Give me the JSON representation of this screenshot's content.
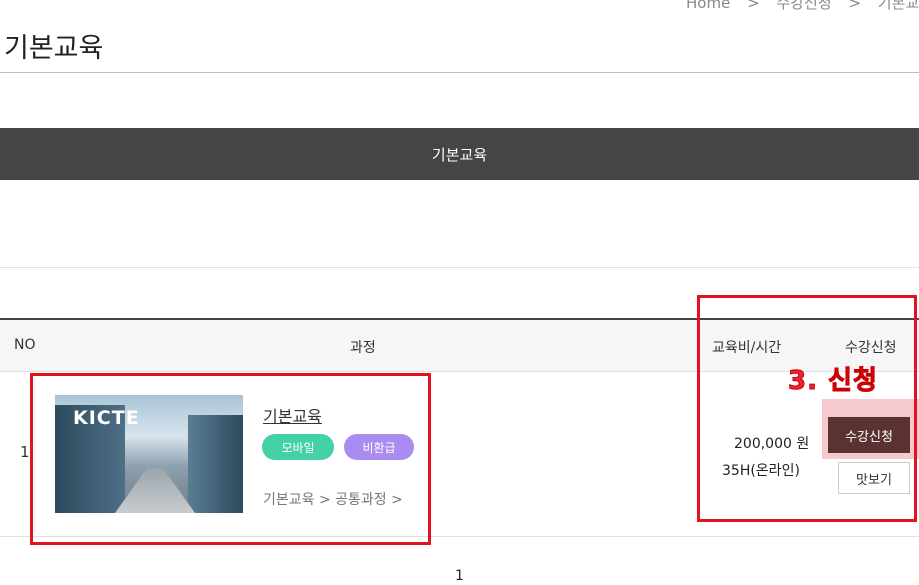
{
  "breadcrumb": {
    "home": "Home",
    "separator": ">",
    "level1": "수강신청",
    "level2": "기본교육"
  },
  "page": {
    "title": "기본교육"
  },
  "category": {
    "header": "기본교육"
  },
  "table": {
    "headers": {
      "no": "NO",
      "course": "과정",
      "fee": "교육비/시간",
      "apply": "수강신청"
    },
    "rows": [
      {
        "no": "1",
        "thumbnail_text": "KICTE",
        "course_name": "기본교육",
        "badges": [
          "모바일",
          "비환급"
        ],
        "path": "기본교육 > 공통과정 >",
        "price": "200,000 원",
        "hours": "35H(온라인)",
        "apply_label": "수강신청",
        "preview_label": "맛보기"
      }
    ]
  },
  "annotation": {
    "step_label": "3. 신청",
    "box_color": "#e3121f"
  },
  "pagination": {
    "current": "1"
  },
  "colors": {
    "category_header_bg": "#454545",
    "apply_button_bg": "#5b3232",
    "badge_mobile": "#45d1a8",
    "badge_nonrefund": "#a98cf0"
  }
}
